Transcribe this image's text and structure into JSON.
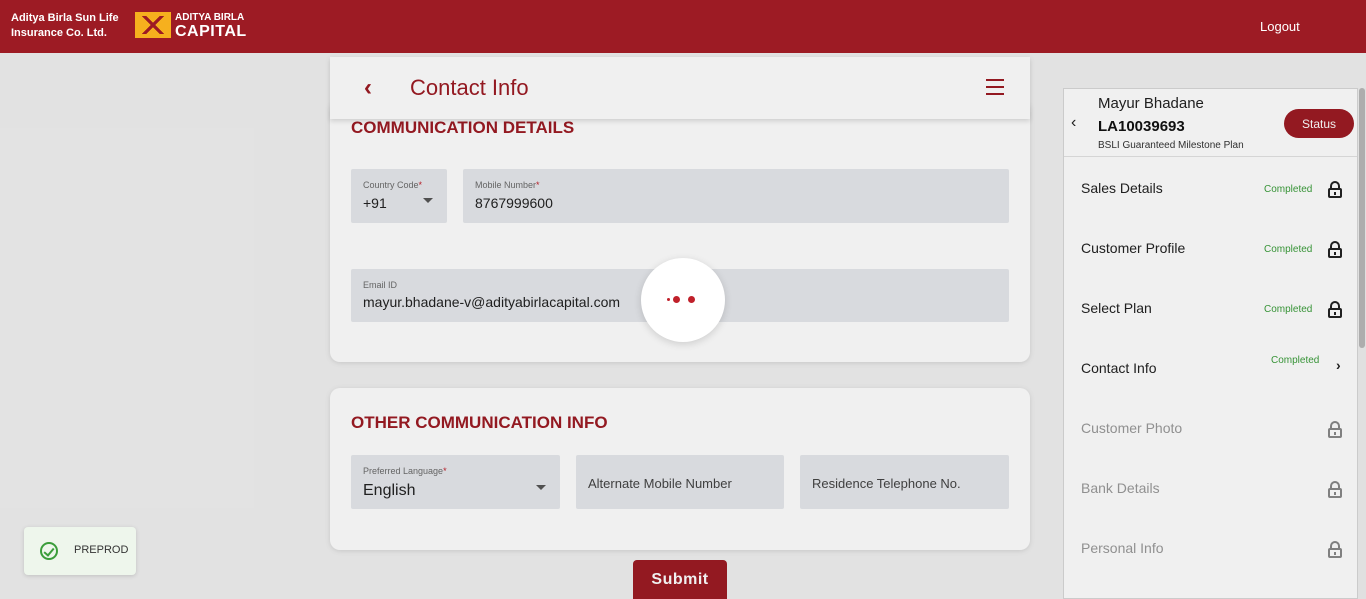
{
  "header": {
    "brand_line1": "Aditya Birla Sun Life",
    "brand_line2": "Insurance Co. Ltd.",
    "logo_top": "ADITYA BIRLA",
    "logo_bottom": "CAPITAL",
    "logout_label": "Logout"
  },
  "page": {
    "title": "Contact Info",
    "back_icon": "chevron-left-icon",
    "menu_icon": "hamburger-menu-icon"
  },
  "communication": {
    "section_title": "COMMUNICATION DETAILS",
    "country_code_label": "Country Code",
    "country_code_value": "+91",
    "mobile_label": "Mobile Number",
    "mobile_value": "8767999600",
    "email_label": "Email ID",
    "email_value": "mayur.bhadane-v@adityabirlacapital.com"
  },
  "other": {
    "section_title": "OTHER COMMUNICATION INFO",
    "language_label": "Preferred Language",
    "language_value": "English",
    "alt_mobile_placeholder": "Alternate Mobile Number",
    "residence_phone_placeholder": "Residence Telephone No."
  },
  "submit_label": "Submit",
  "sidebar": {
    "customer_name": "Mayur Bhadane",
    "application_id": "LA10039693",
    "plan_name": "BSLI Guaranteed Milestone Plan",
    "status_label": "Status",
    "steps": [
      {
        "label": "Sales Details",
        "status": "Completed"
      },
      {
        "label": "Customer Profile",
        "status": "Completed"
      },
      {
        "label": "Select Plan",
        "status": "Completed"
      },
      {
        "label": "Contact Info",
        "status": "Completed"
      },
      {
        "label": "Customer Photo",
        "status": ""
      },
      {
        "label": "Bank Details",
        "status": ""
      },
      {
        "label": "Personal Info",
        "status": ""
      }
    ]
  },
  "environment_badge": "PREPROD",
  "colors": {
    "brand": "#9d1b24",
    "completed": "#3b9d3b"
  }
}
